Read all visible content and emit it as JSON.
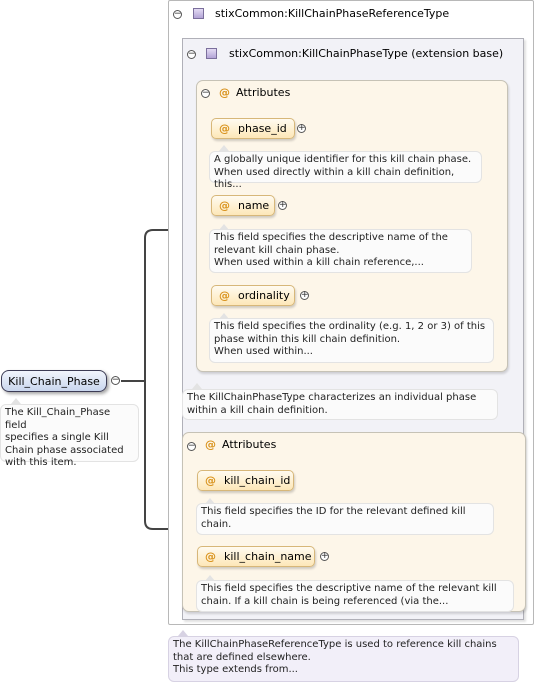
{
  "root": {
    "label": "Kill_Chain_Phase",
    "note": "The Kill_Chain_Phase field\nspecifies a single Kill\nChain phase associated\nwith this item."
  },
  "outer_type": {
    "name": "stixCommon:KillChainPhaseReferenceType",
    "note": "The KillChainPhaseReferenceType is used to reference kill chains\nthat are defined elsewhere.\nThis type extends from..."
  },
  "base_type": {
    "name": "stixCommon:KillChainPhaseType (extension base)",
    "note": "The KillChainPhaseType characterizes an individual phase\nwithin a kill chain definition.",
    "attributes_title": "Attributes",
    "attributes": [
      {
        "name": "phase_id",
        "note": "A globally unique identifier for this kill chain phase.\nWhen used directly within a kill chain definition, this..."
      },
      {
        "name": "name",
        "note": "This field specifies the descriptive name of the\nrelevant kill chain phase.\nWhen used within a kill chain reference,..."
      },
      {
        "name": "ordinality",
        "note": "This field specifies the ordinality (e.g. 1, 2 or 3) of this\nphase within this kill chain definition.\nWhen used within..."
      }
    ]
  },
  "ext_attributes": {
    "title": "Attributes",
    "attributes": [
      {
        "name": "kill_chain_id",
        "note": "This field specifies the ID for the relevant defined kill\nchain."
      },
      {
        "name": "kill_chain_name",
        "note": "This field specifies the descriptive name of the relevant kill\nchain. If a kill chain is being referenced (via the..."
      }
    ]
  },
  "icons": {
    "collapse": "minus-circle-icon",
    "expand": "plus-circle-icon",
    "complex_type": "complex-type-icon",
    "attribute": "attribute-at-icon"
  },
  "colors": {
    "root_fill": "#dde6f6",
    "attribute_accent": "#d9931e",
    "type_icon": "#b3a4d6",
    "connector": "#444444"
  }
}
